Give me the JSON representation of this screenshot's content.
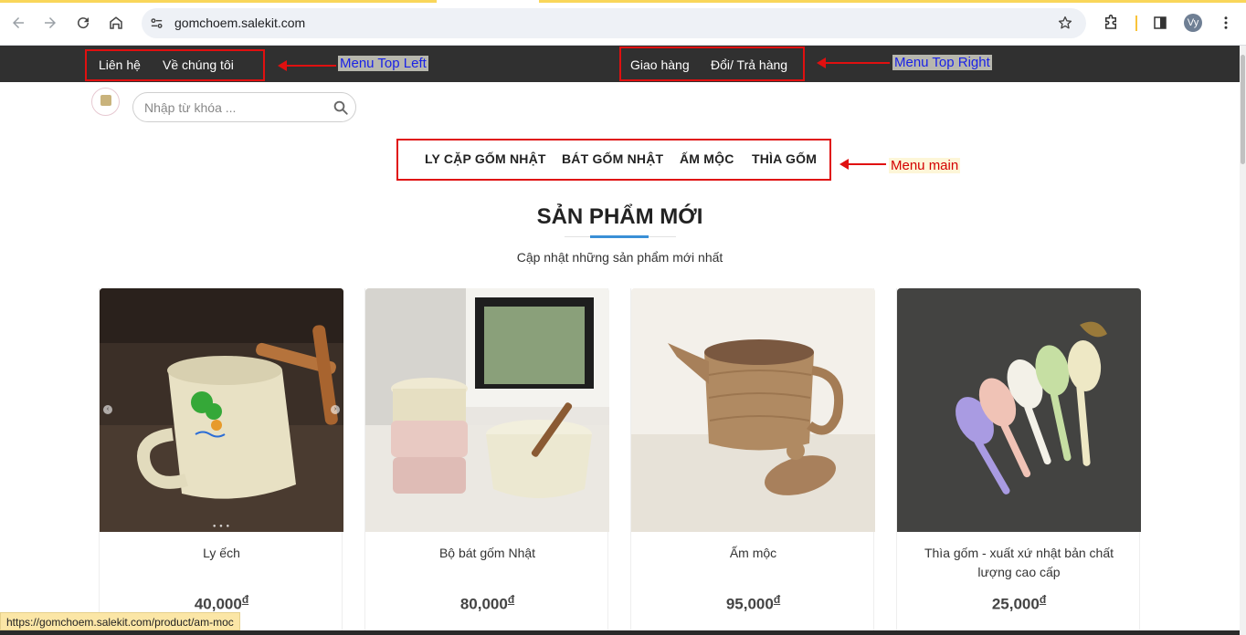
{
  "browser": {
    "url": "gomchoem.salekit.com",
    "profile_initials": "Vy"
  },
  "topbar": {
    "left_links": [
      "Liên hệ",
      "Về chúng tôi"
    ],
    "right_links": [
      "Giao hàng",
      "Đổi/ Trả hàng"
    ]
  },
  "annotations": {
    "top_left": "Menu Top Left",
    "top_right": "Menu Top Right",
    "main": "Menu main"
  },
  "search": {
    "placeholder": "Nhập từ khóa ..."
  },
  "main_menu": [
    "LY CẶP GỐM NHẬT",
    "BÁT GỐM NHẬT",
    "ẤM MỘC",
    "THÌA GỐM"
  ],
  "section": {
    "title": "SẢN PHẨM MỚI",
    "subtitle": "Cập nhật những sản phẩm mới nhất"
  },
  "products": [
    {
      "name": "Ly ếch",
      "price": "40,000",
      "currency": "đ",
      "image": "frog-mug"
    },
    {
      "name": "Bộ bát gốm Nhật",
      "price": "80,000",
      "currency": "đ",
      "image": "bowl-set"
    },
    {
      "name": "Ấm mộc",
      "price": "95,000",
      "currency": "đ",
      "image": "clay-teapot"
    },
    {
      "name": "Thìa gốm - xuất xứ nhật bản chất lượng cao cấp",
      "price": "25,000",
      "currency": "đ",
      "image": "ceramic-spoons"
    }
  ],
  "status_url": "https://gomchoem.salekit.com/product/am-moc",
  "colors": {
    "topbar_bg": "#303030",
    "annotation_red": "#e01010",
    "annotation_blue_text": "#1a22e6",
    "accent_underline": "#3a8fd6"
  }
}
